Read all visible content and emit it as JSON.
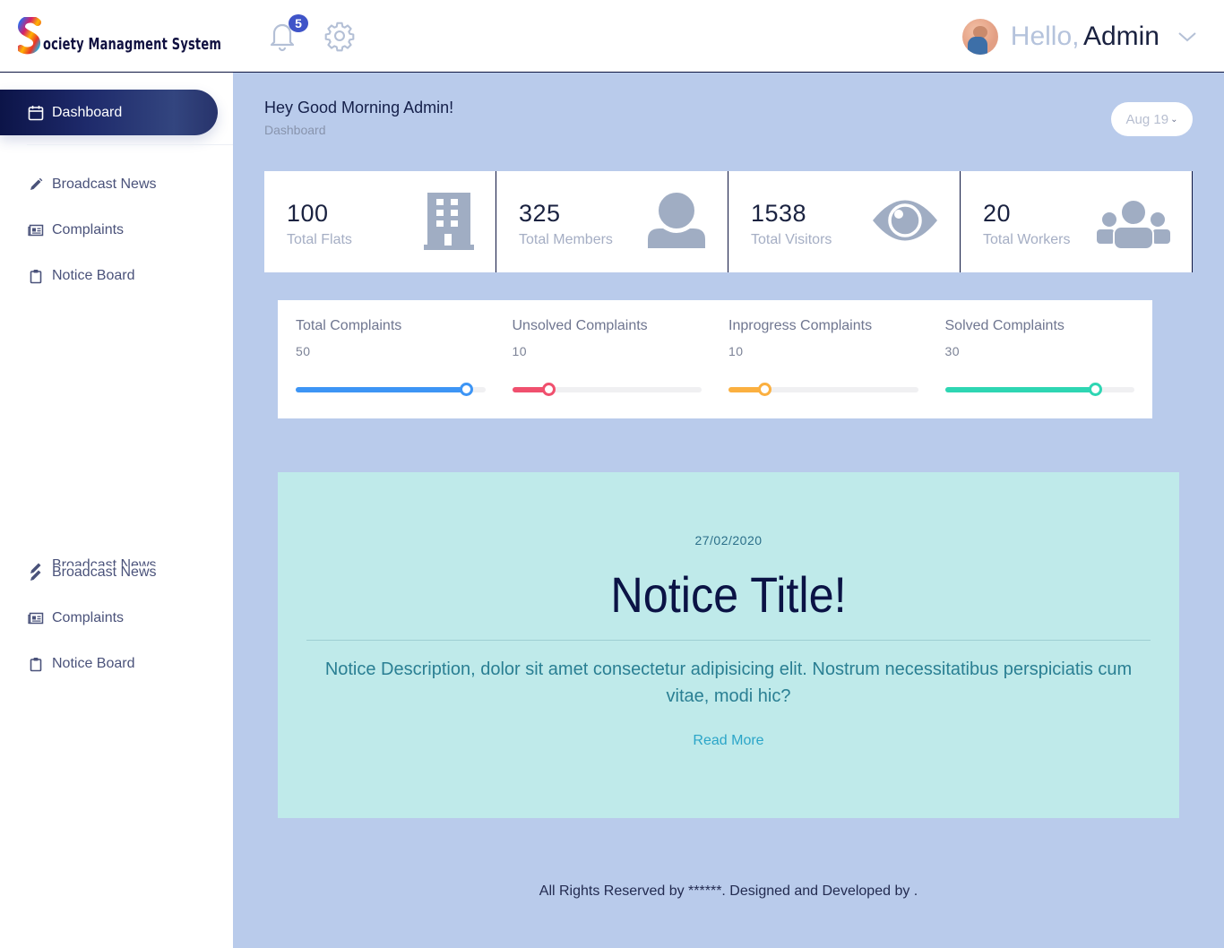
{
  "brand": {
    "title": "ociety Managment System",
    "logo_letter": "S"
  },
  "header": {
    "notifications": {
      "icon": "bell-icon",
      "count": "5"
    },
    "settings": {
      "icon": "gear-icon"
    },
    "user": {
      "greeting": "Hello,",
      "name": "Admin",
      "avatar": "avatar-photo",
      "menu_icon": "chevron-down-icon"
    }
  },
  "sidebar": {
    "active": {
      "label": "Dashboard",
      "icon": "calendar-icon"
    },
    "items": [
      {
        "label": "Broadcast News",
        "icon": "pencil-icon"
      },
      {
        "label": "Complaints",
        "icon": "newspaper-icon"
      },
      {
        "label": "Notice Board",
        "icon": "clipboard-icon"
      }
    ],
    "items_repeat": [
      {
        "label": "Broadcast News",
        "icon": "pencil-icon"
      },
      {
        "label": "Complaints",
        "icon": "newspaper-icon"
      },
      {
        "label": "Notice Board",
        "icon": "clipboard-icon"
      }
    ]
  },
  "page": {
    "greeting": "Hey Good Morning Admin!",
    "breadcrumb": "Dashboard",
    "date_filter": "Aug 19"
  },
  "stats": [
    {
      "value": "100",
      "label": "Total Flats",
      "icon": "building-icon"
    },
    {
      "value": "325",
      "label": "Total Members",
      "icon": "user-icon"
    },
    {
      "value": "1538",
      "label": "Total Visitors",
      "icon": "eye-icon"
    },
    {
      "value": "20",
      "label": "Total Workers",
      "icon": "users-group-icon"
    }
  ],
  "complaints": [
    {
      "title": "Total Complaints",
      "value": "50",
      "progress": 0.9,
      "color": "#3d95f5"
    },
    {
      "title": "Unsolved Complaints",
      "value": "10",
      "progress": 0.19,
      "color": "#f0506e"
    },
    {
      "title": "Inprogress Complaints",
      "value": "10",
      "progress": 0.19,
      "color": "#fbb040"
    },
    {
      "title": "Solved Complaints",
      "value": "30",
      "progress": 0.79,
      "color": "#2ed6b3"
    }
  ],
  "notice": {
    "date": "27/02/2020",
    "title": "Notice Title!",
    "description": "Notice Description, dolor sit amet consectetur adipisicing elit. Nostrum necessitatibus perspiciatis cum vitae, modi hic?",
    "link_label": "Read More"
  },
  "footer": {
    "text": "All Rights Reserved by ******. Designed and Developed by ."
  }
}
